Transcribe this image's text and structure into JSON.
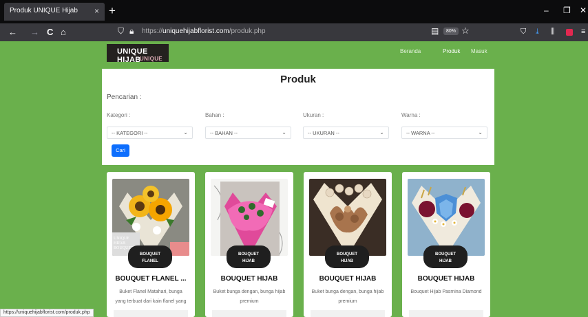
{
  "browser": {
    "tab_title": "Produk UNIQUE Hijab",
    "tab_close": "×",
    "new_tab": "+",
    "win_minimize": "–",
    "win_restore": "❐",
    "win_close": "✕",
    "back": "←",
    "forward": "→",
    "reload": "C",
    "home": "⌂",
    "url_scheme": "https://",
    "url_host": "uniquehijabflorist.com",
    "url_path": "/produk.php",
    "zoom": "80%",
    "status_url": "https://uniquehijabflorist.com/produk.php"
  },
  "site": {
    "logo_text": "UNIQUE HIJAB",
    "logo_subtext": "UNIQUE HI",
    "nav": [
      "Beranda",
      "Produk",
      "Masuk"
    ]
  },
  "filter": {
    "title": "Produk",
    "search_label": "Pencarian :",
    "fields": [
      {
        "label": "Kategori :",
        "value": "-- KATEGORI --"
      },
      {
        "label": "Bahan :",
        "value": "-- BAHAN --"
      },
      {
        "label": "Ukuran :",
        "value": "-- UKURAN --"
      },
      {
        "label": "Warna :",
        "value": "-- WARNA --"
      }
    ],
    "button": "Cari"
  },
  "products": [
    {
      "badge_line1": "BOUQUET",
      "badge_line2": "FLANEL",
      "name": "BOUQUET FLANEL ...",
      "desc": "Buket Flanel Matahari, bunga yang terbuat dari kain flanel yang",
      "image_overlay": "UNIQUE HIJAB BOUQUET"
    },
    {
      "badge_line1": "BOUQUET",
      "badge_line2": "HIJAB",
      "name": "BOUQUET HIJAB",
      "desc": "Buket bunga dengan, bunga hijab premium"
    },
    {
      "badge_line1": "BOUQUET",
      "badge_line2": "HIJAB",
      "name": "BOUQUET HIJAB",
      "desc": "Buket bunga dengan, bunga hijab premium"
    },
    {
      "badge_line1": "BOUQUET",
      "badge_line2": "HIJAB",
      "name": "BOUQUET HIJAB",
      "desc": "Bouquet Hijab Pasmina Diamond"
    }
  ],
  "colors": {
    "page_bg": "#6ab04c",
    "button": "#0d6efd",
    "chrome": "#38383d"
  }
}
